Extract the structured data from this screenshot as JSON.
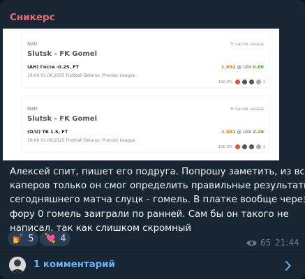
{
  "post": {
    "sender": "Сникерс",
    "body_lines": [
      "Алексей спит, пишет его подруга. Попрошу заметить, из всех",
      "каперов только он смог определить правильные результаты",
      "сегодняшнего матча слуцк - гомель. В платке вообще через",
      "фору 0 гомель заиграли по ранней. Сам бы он такого не",
      "написал, так как слишком скромный"
    ],
    "views": "65",
    "time": "21:44"
  },
  "media": {
    "cards": [
      {
        "author": "Natr",
        "time_ago": "5 часов назад",
        "teams": "Slutsk - FK Gomel",
        "bet": "(AH) Гости -0.25, FT",
        "odds": "1.892",
        "udi": "0.80",
        "meta": "16:00 01.06.2025 Football Belarus. Premier League.",
        "percent": "100.0%",
        "counter": "1"
      },
      {
        "author": "Natr",
        "time_ago": "6 часов назад",
        "teams": "Slutsk - FK Gomel",
        "bet": "(O/U) ТБ 1.5, FT",
        "odds": "1.581",
        "udi": "2.26",
        "meta": "16:00 01.06.2025 Football Belarus. Premier League.",
        "percent": "100.0%",
        "counter": "1"
      }
    ],
    "odds_sep": "@",
    "udi_label": "UDI"
  },
  "reactions": [
    {
      "emoji": "💅",
      "icon": "nail-polish-icon",
      "count": "5"
    },
    {
      "emoji": "💘",
      "icon": "heart-arrow-icon",
      "count": "4"
    }
  ],
  "comments": {
    "label": "1 комментарий"
  },
  "colors": {
    "background": "#0e1621",
    "bubble": "#182533",
    "sender": "#e76a74",
    "link": "#6ab3f3",
    "meta_text": "#6d7f8f",
    "reaction_bg": "#2a3d52"
  }
}
